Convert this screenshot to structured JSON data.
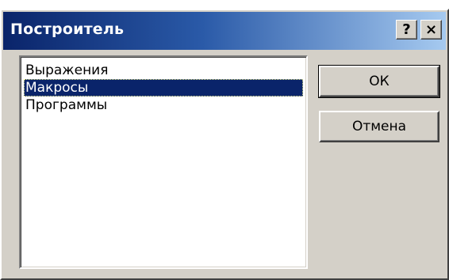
{
  "window": {
    "title": "Построитель",
    "help_button": "?",
    "close_button": "×"
  },
  "list": {
    "items": [
      {
        "label": "Выражения",
        "selected": false
      },
      {
        "label": "Макросы",
        "selected": true
      },
      {
        "label": "Программы",
        "selected": false
      }
    ]
  },
  "buttons": {
    "ok_label": "ОК",
    "cancel_label": "Отмена"
  },
  "colors": {
    "title_gradient_start": "#0a246a",
    "title_gradient_end": "#a6caf0",
    "selection": "#0a246a",
    "face": "#d4d0c8"
  }
}
